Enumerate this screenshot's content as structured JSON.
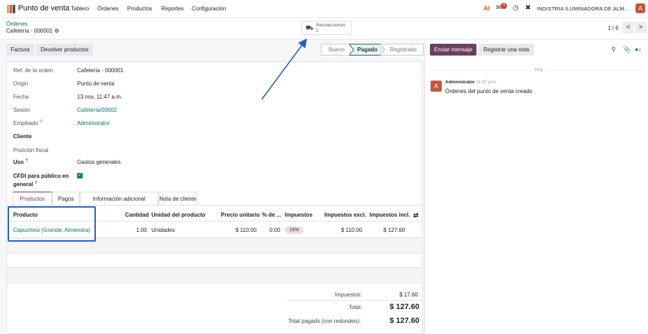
{
  "topbar": {
    "app_name": "Punto de venta",
    "menu": [
      "Tablero",
      "Órdenes",
      "Productos",
      "Reportes",
      "Configuración"
    ],
    "ai_label": "AI",
    "chat_count": "4",
    "company": "INDISTRIA ILUMINADORA DE ALM...",
    "user_initial": "A"
  },
  "breadcrumb": {
    "parent": "Órdenes",
    "current": "Cafetería - 000001"
  },
  "smart_button": {
    "label": "Recolecciones",
    "value": "1"
  },
  "pager": {
    "text": "1 / 6",
    "prev": "<",
    "next": ">"
  },
  "actions": {
    "invoice": "Factura",
    "refund": "Devolver productos"
  },
  "statusbar": {
    "stages": [
      "Nuevo",
      "Pagado",
      "Registrado"
    ],
    "active": "Pagado"
  },
  "form": {
    "ref_label": "Ref. de la orden",
    "ref_value": "Cafetería - 000001",
    "origin_label": "Origin",
    "origin_value": "Punto de venta",
    "date_label": "Fecha",
    "date_value": "13 nov, 11:47 a.m.",
    "session_label": "Sesión",
    "session_value": "Cafetería/00002",
    "employee_label": "Empleado",
    "employee_value": "Administrator",
    "customer_label": "Cliente",
    "fiscal_label": "Posición fiscal",
    "usage_label": "Uso",
    "usage_value": "Gastos generales",
    "cfdi_label_1": "CFDI para público en",
    "cfdi_label_2": "general",
    "help_mark": "?"
  },
  "tabs": [
    "Productos",
    "Pagos",
    "Información adicional",
    "Nota de cliente"
  ],
  "table": {
    "headers": [
      "Producto",
      "Cantidad",
      "Unidad del producto",
      "Precio unitario",
      "% de ...",
      "Impuestos",
      "Impuestos excl.",
      "Impuestos incl."
    ],
    "rows": [
      {
        "product": "Capuchino (Grande, Almendra)",
        "qty": "1.00",
        "uom": "Unidades",
        "price": "$ 110.00",
        "discount": "0.00",
        "tax": "16%",
        "subtotal": "$ 110.00",
        "total": "$ 127.60"
      }
    ]
  },
  "totals": {
    "tax_label": "Impuestos:",
    "tax_value": "$ 17.60",
    "total_label": "Total:",
    "total_value": "$ 127.60",
    "paid_label": "Total pagado (con redondeo):",
    "paid_value": "$ 127.60"
  },
  "chatter": {
    "send_message": "Enviar mensaje",
    "log_note": "Registrar una nota",
    "followers": "1",
    "day": "Hoy",
    "author": "Administrator",
    "time": "11:47 a.m.",
    "message": "Órdenes del punto de venta creado",
    "avatar_initial": "A"
  },
  "icons": {
    "apps": "apps-icon",
    "search": "search-icon",
    "attach": "paperclip-icon",
    "followers": "user-icon",
    "truck": "truck-icon"
  },
  "colors": {
    "brand": "#6b3f5f",
    "link": "#00756a",
    "annotation": "#1d5fc9",
    "avatar": "#c4543a"
  }
}
